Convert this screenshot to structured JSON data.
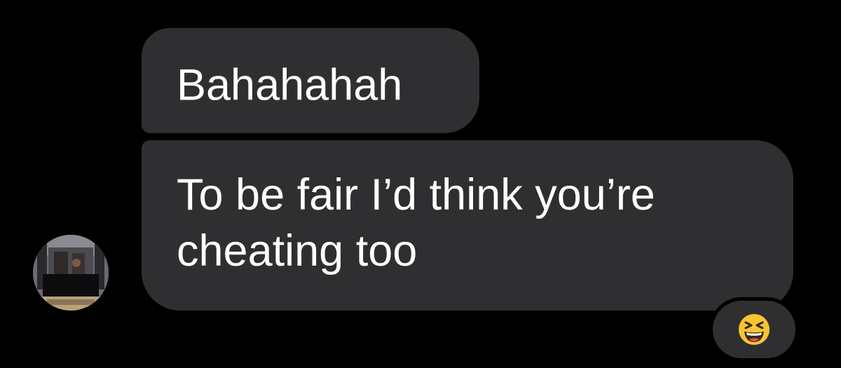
{
  "messages": [
    {
      "text": "Bahahahah"
    },
    {
      "text": "To be fair I’d think you’re cheating too"
    }
  ],
  "reaction": {
    "icon": "grinning-squinting-face-icon"
  },
  "avatar": {
    "icon": "contact-avatar"
  },
  "colors": {
    "background": "#000000",
    "bubble": "#2f2f31",
    "text": "#ffffff",
    "emoji": "#f7c534"
  }
}
